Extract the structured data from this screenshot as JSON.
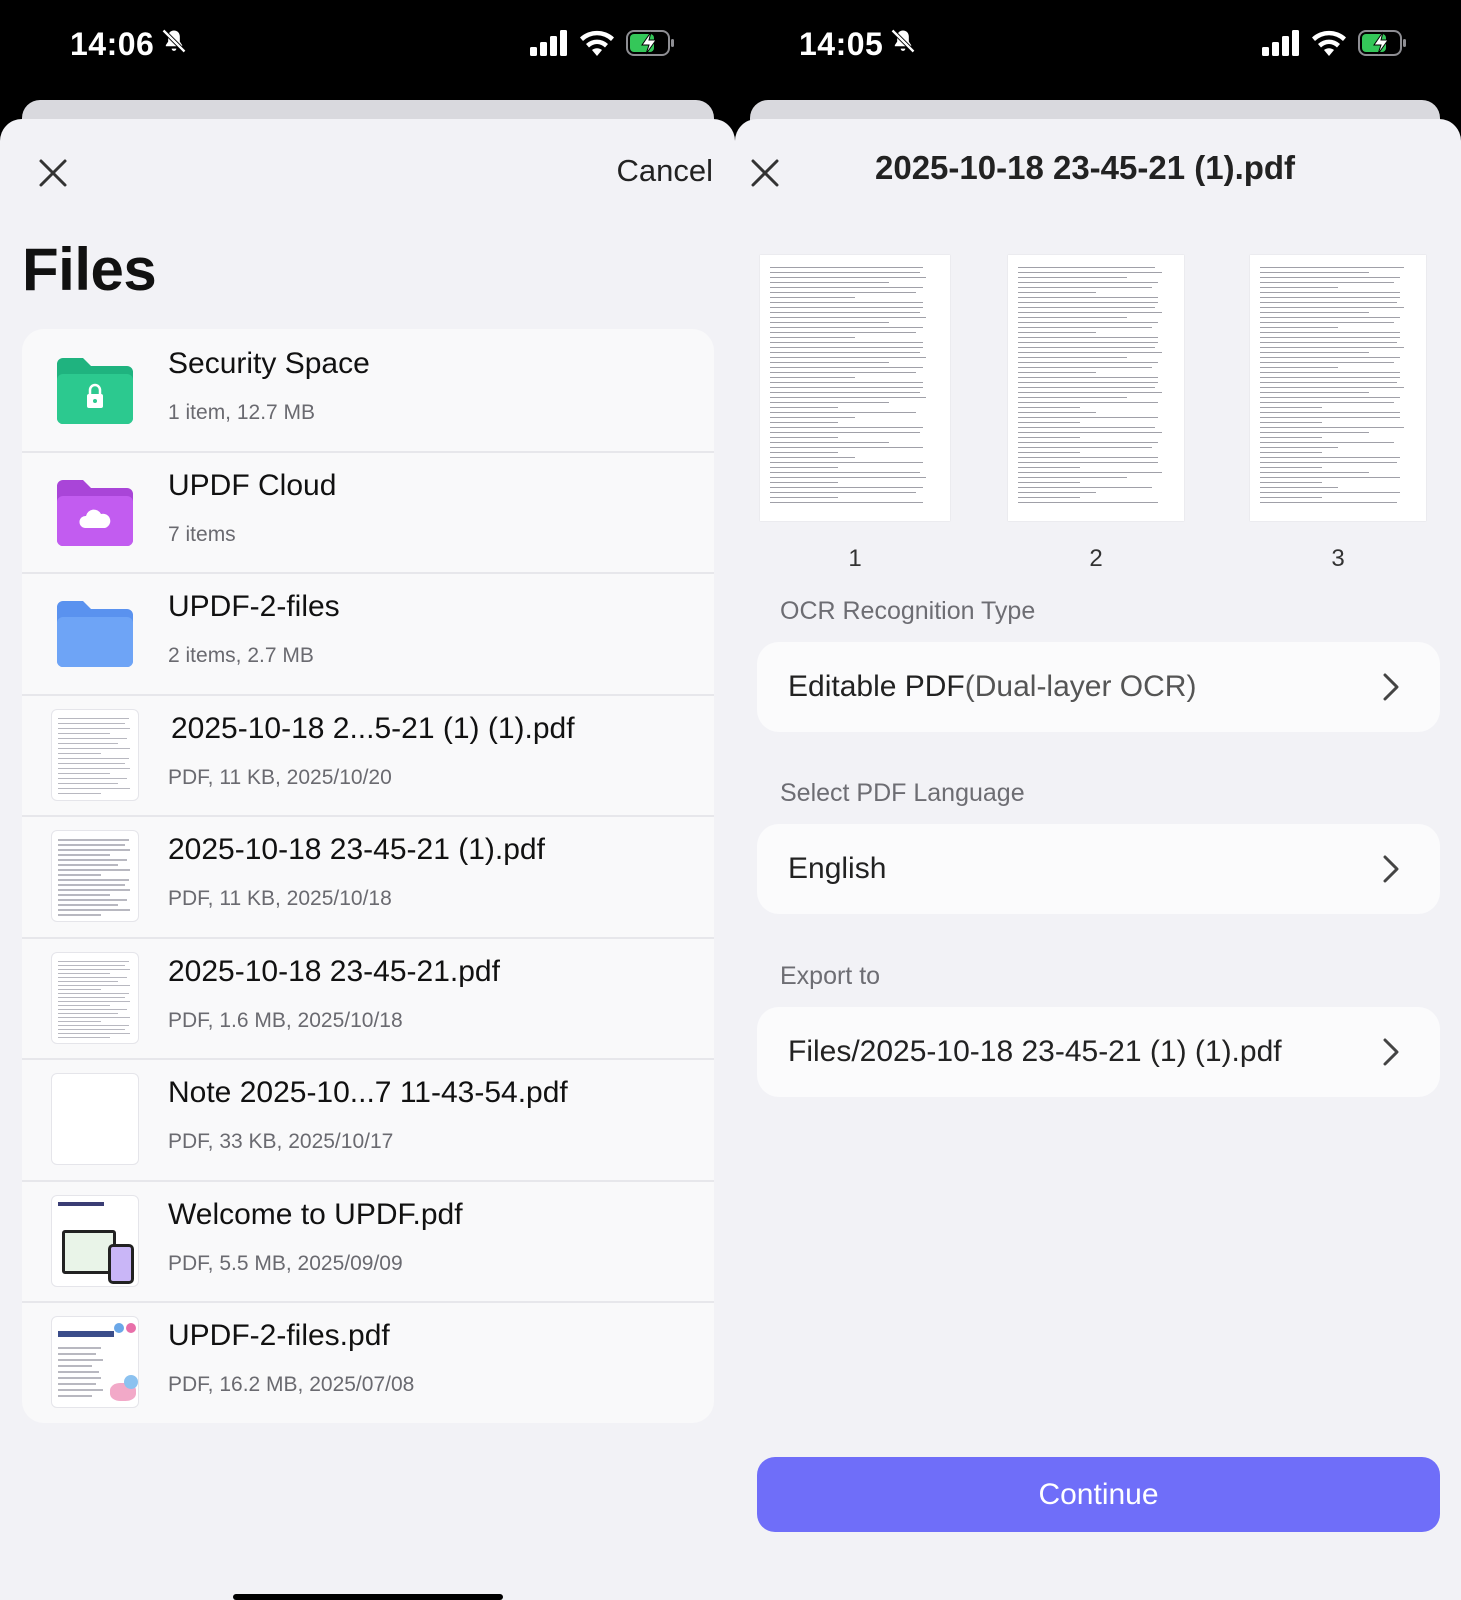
{
  "left": {
    "status": {
      "time": "14:06"
    },
    "cancel_label": "Cancel",
    "title": "Files",
    "items": [
      {
        "name": "Security Space",
        "meta": "1 item, 12.7 MB",
        "icon": "lock-folder-icon",
        "color": "#2cc98f"
      },
      {
        "name": "UPDF Cloud",
        "meta": "7 items",
        "icon": "cloud-folder-icon",
        "color": "#c25cf0"
      },
      {
        "name": "UPDF-2-files",
        "meta": "2 items, 2.7 MB",
        "icon": "folder-icon",
        "color": "#6ea4f6"
      },
      {
        "name": "2025-10-18 2...5-21 (1) (1).pdf",
        "meta": "PDF, 11 KB, 2025/10/20",
        "icon": "pdf-thumbnail"
      },
      {
        "name": "2025-10-18 23-45-21 (1).pdf",
        "meta": "PDF, 11 KB, 2025/10/18",
        "icon": "pdf-thumbnail"
      },
      {
        "name": "2025-10-18 23-45-21.pdf",
        "meta": "PDF, 1.6 MB, 2025/10/18",
        "icon": "pdf-thumbnail"
      },
      {
        "name": "Note 2025-10...7 11-43-54.pdf",
        "meta": "PDF, 33 KB, 2025/10/17",
        "icon": "blank-pdf-thumbnail"
      },
      {
        "name": "Welcome to UPDF.pdf",
        "meta": "PDF, 5.5 MB, 2025/09/09",
        "icon": "welcome-pdf-thumbnail"
      },
      {
        "name": "UPDF-2-files.pdf",
        "meta": "PDF, 16.2 MB, 2025/07/08",
        "icon": "brochure-pdf-thumbnail"
      }
    ]
  },
  "right": {
    "status": {
      "time": "14:05"
    },
    "doc_title": "2025-10-18 23-45-21 (1).pdf",
    "pages": [
      "1",
      "2",
      "3"
    ],
    "ocr_label": "OCR Recognition Type",
    "ocr_value_main": "Editable PDF",
    "ocr_value_sub": "(Dual-layer OCR)",
    "language_label": "Select PDF Language",
    "language_value": "English",
    "export_label": "Export to",
    "export_value": "Files/2025-10-18 23-45-21 (1) (1).pdf",
    "continue_label": "Continue"
  },
  "colors": {
    "accent": "#6f6ef9",
    "battery": "#34c759"
  }
}
